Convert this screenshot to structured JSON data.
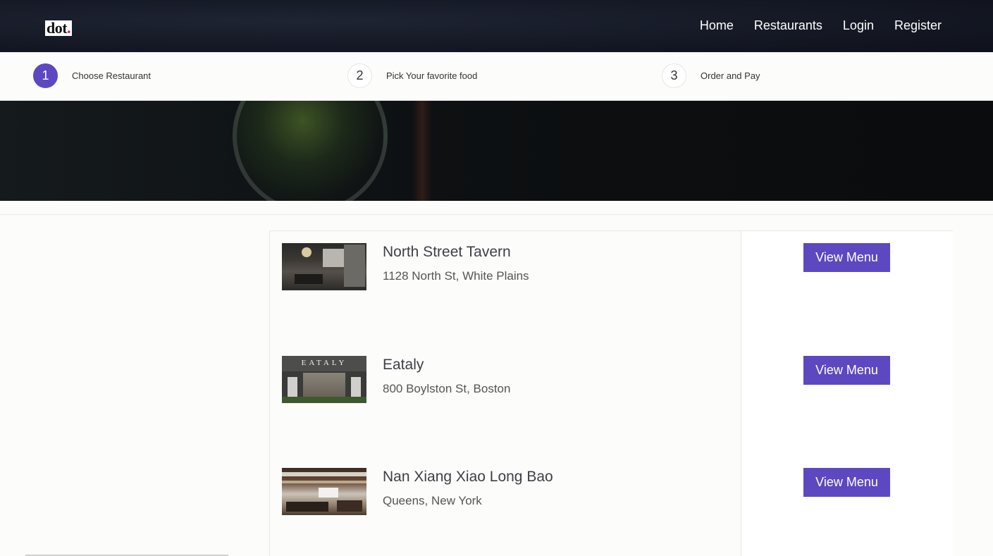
{
  "header": {
    "logo_text": "dot",
    "logo_dot": ".",
    "nav": [
      {
        "label": "Home"
      },
      {
        "label": "Restaurants"
      },
      {
        "label": "Login"
      },
      {
        "label": "Register"
      }
    ]
  },
  "steps": [
    {
      "number": "1",
      "label": "Choose Restaurant",
      "active": true
    },
    {
      "number": "2",
      "label": "Pick Your favorite food",
      "active": false
    },
    {
      "number": "3",
      "label": "Order and Pay",
      "active": false
    }
  ],
  "restaurants": [
    {
      "name": "North Street Tavern",
      "address": "1128 North St, White Plains",
      "button": "View Menu",
      "image_sign": ""
    },
    {
      "name": "Eataly",
      "address": "800 Boylston St, Boston",
      "button": "View Menu",
      "image_sign": "EATALY"
    },
    {
      "name": "Nan Xiang Xiao Long Bao",
      "address": "Queens, New York",
      "button": "View Menu",
      "image_sign": ""
    }
  ],
  "colors": {
    "accent": "#5d48c1",
    "nav_bg": "#141824",
    "logo_dot": "#d0223a"
  }
}
